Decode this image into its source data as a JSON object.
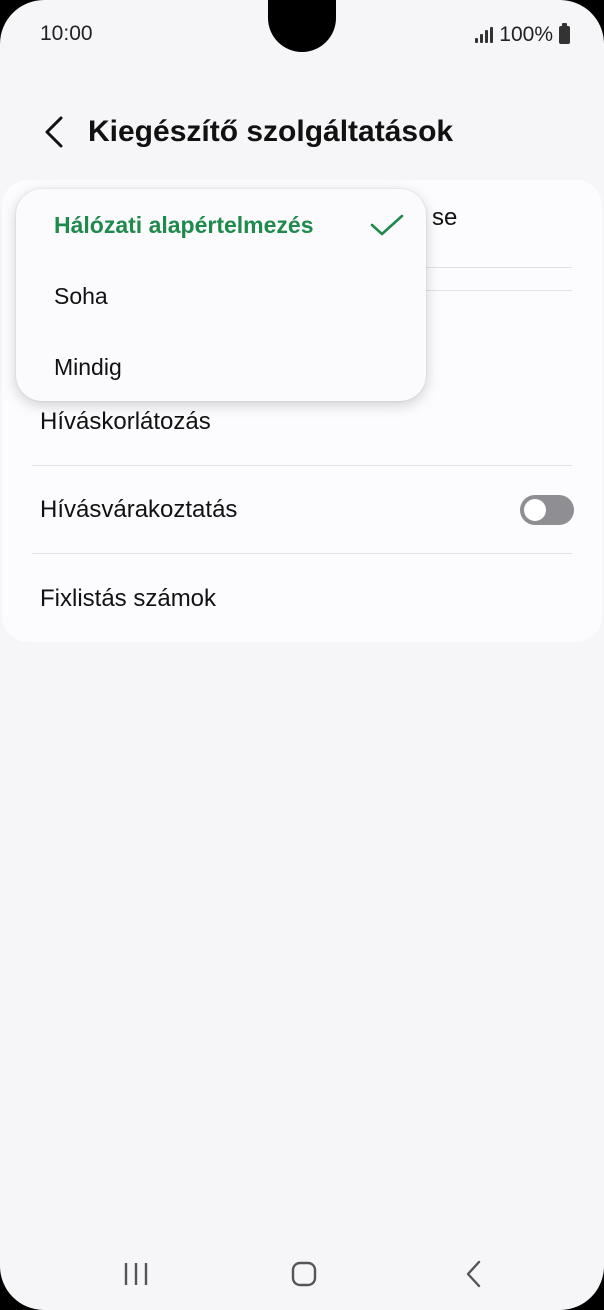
{
  "status": {
    "time": "10:00",
    "battery": "100%"
  },
  "header": {
    "title": "Kiegészítő szolgáltatások"
  },
  "list": {
    "partial_text": "se",
    "items": [
      {
        "label": "Híváskorlátozás"
      },
      {
        "label": "Hívásvárakoztatás",
        "toggle_on": false
      },
      {
        "label": "Fixlistás számok"
      }
    ]
  },
  "popup": {
    "options": [
      {
        "label": "Hálózati alapértelmezés",
        "selected": true
      },
      {
        "label": "Soha",
        "selected": false
      },
      {
        "label": "Mindig",
        "selected": false
      }
    ]
  },
  "colors": {
    "accent": "#1f8a4c",
    "toggle_off": "#8e8e93"
  }
}
